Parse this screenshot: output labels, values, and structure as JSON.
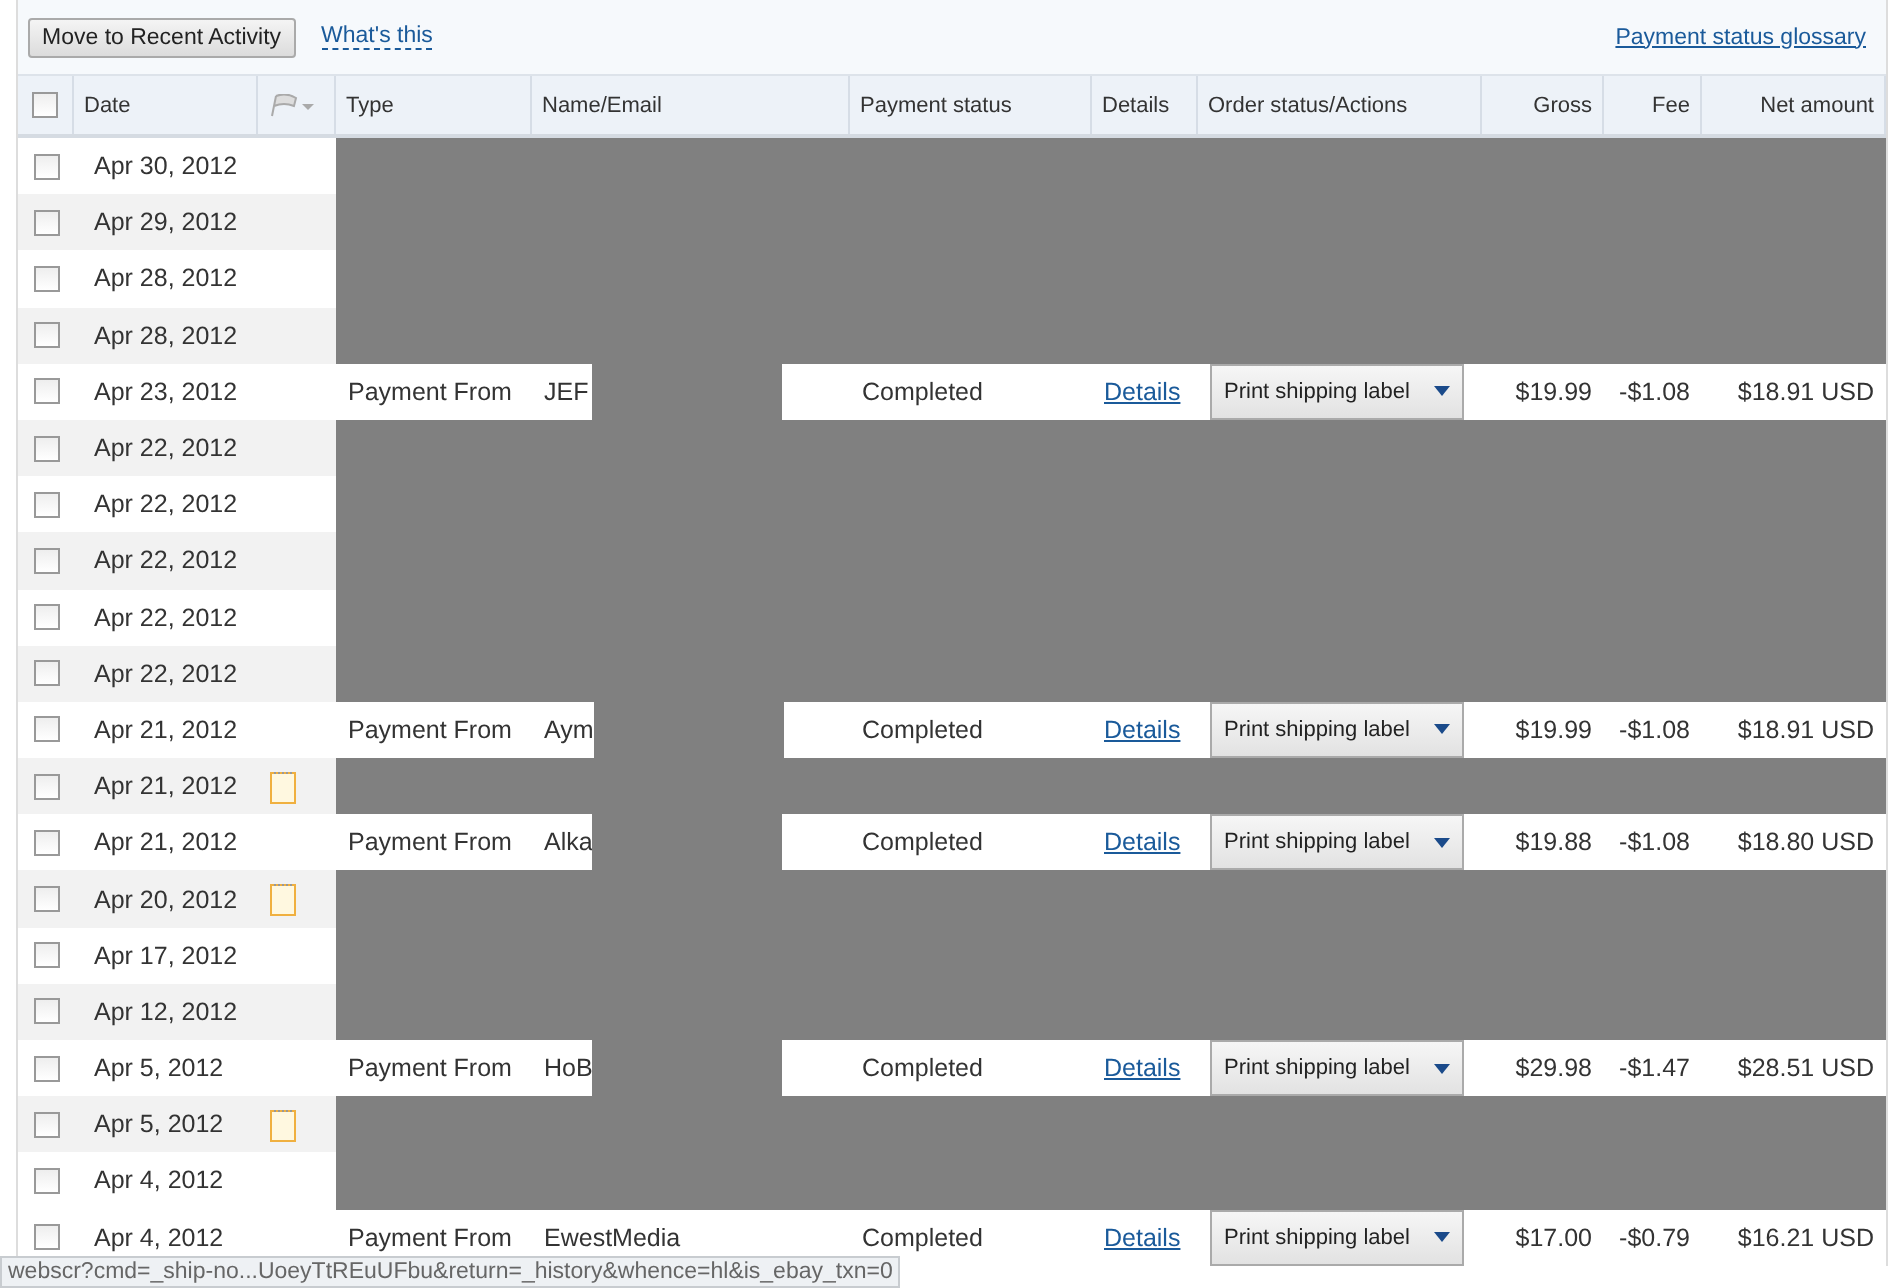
{
  "toolbar": {
    "move_button": "Move to Recent Activity",
    "help_link": "What's this",
    "glossary_link": "Payment status glossary"
  },
  "table": {
    "select_all": {
      "checked": false
    },
    "columns": [
      "Date",
      "",
      "Type",
      "Name/Email",
      "Payment status",
      "Details",
      "Order status/Actions",
      "Gross",
      "Fee",
      "Net amount"
    ],
    "rows": [
      {
        "kind": "redacted",
        "checked": false,
        "date": "Apr 30, 2012",
        "note": false
      },
      {
        "kind": "redacted",
        "checked": false,
        "date": "Apr 29, 2012",
        "note": false
      },
      {
        "kind": "redacted",
        "checked": false,
        "date": "Apr 28, 2012",
        "note": false
      },
      {
        "kind": "redacted",
        "checked": false,
        "date": "Apr 28, 2012",
        "note": false
      },
      {
        "kind": "payment",
        "checked": false,
        "date": "Apr 23, 2012",
        "note": false,
        "type": "Payment From",
        "name": "JEF",
        "status": "Completed",
        "details": "Details",
        "action": "Print shipping label",
        "gross": "$19.99",
        "fee": "-$1.08",
        "net": "$18.91 USD",
        "name_hidden": true
      },
      {
        "kind": "redacted",
        "checked": false,
        "date": "Apr 22, 2012",
        "note": false
      },
      {
        "kind": "redacted",
        "checked": false,
        "date": "Apr 22, 2012",
        "note": false
      },
      {
        "kind": "redacted",
        "checked": false,
        "date": "Apr 22, 2012",
        "note": false
      },
      {
        "kind": "redacted",
        "checked": false,
        "date": "Apr 22, 2012",
        "note": false
      },
      {
        "kind": "redacted",
        "checked": false,
        "date": "Apr 22, 2012",
        "note": false
      },
      {
        "kind": "payment",
        "checked": false,
        "date": "Apr 21, 2012",
        "note": false,
        "type": "Payment From",
        "name": "Aym",
        "status": "Completed",
        "details": "Details",
        "action": "Print shipping label",
        "gross": "$19.99",
        "fee": "-$1.08",
        "net": "$18.91 USD",
        "name_hidden": true
      },
      {
        "kind": "redacted",
        "checked": false,
        "date": "Apr 21, 2012",
        "note": true
      },
      {
        "kind": "payment",
        "checked": false,
        "date": "Apr 21, 2012",
        "note": false,
        "type": "Payment From",
        "name": "Alka",
        "status": "Completed",
        "details": "Details",
        "action": "Print shipping label",
        "gross": "$19.88",
        "fee": "-$1.08",
        "net": "$18.80 USD",
        "name_hidden": true
      },
      {
        "kind": "redacted",
        "checked": false,
        "date": "Apr 20, 2012",
        "note": true
      },
      {
        "kind": "redacted",
        "checked": false,
        "date": "Apr 17, 2012",
        "note": false
      },
      {
        "kind": "redacted",
        "checked": false,
        "date": "Apr 12, 2012",
        "note": false
      },
      {
        "kind": "payment",
        "checked": false,
        "date": "Apr 5, 2012",
        "note": false,
        "type": "Payment From",
        "name": "HoB",
        "status": "Completed",
        "details": "Details",
        "action": "Print shipping label",
        "gross": "$29.98",
        "fee": "-$1.47",
        "net": "$28.51 USD",
        "name_hidden": true
      },
      {
        "kind": "redacted",
        "checked": false,
        "date": "Apr 5, 2012",
        "note": true
      },
      {
        "kind": "redacted",
        "checked": false,
        "date": "Apr 4, 2012",
        "note": false
      },
      {
        "kind": "payment",
        "checked": false,
        "date": "Apr 4, 2012",
        "note": false,
        "type": "Payment From",
        "name": "EwestMedia",
        "status": "Completed",
        "details": "Details",
        "action": "Print shipping label",
        "gross": "$17.00",
        "fee": "-$0.79",
        "net": "$16.21 USD",
        "name_hidden": false
      }
    ]
  },
  "status_bar": {
    "url": "webscr?cmd=_ship-no...UoeyTtREuUFbu&return=_history&whence=hl&is_ebay_txn=0"
  }
}
